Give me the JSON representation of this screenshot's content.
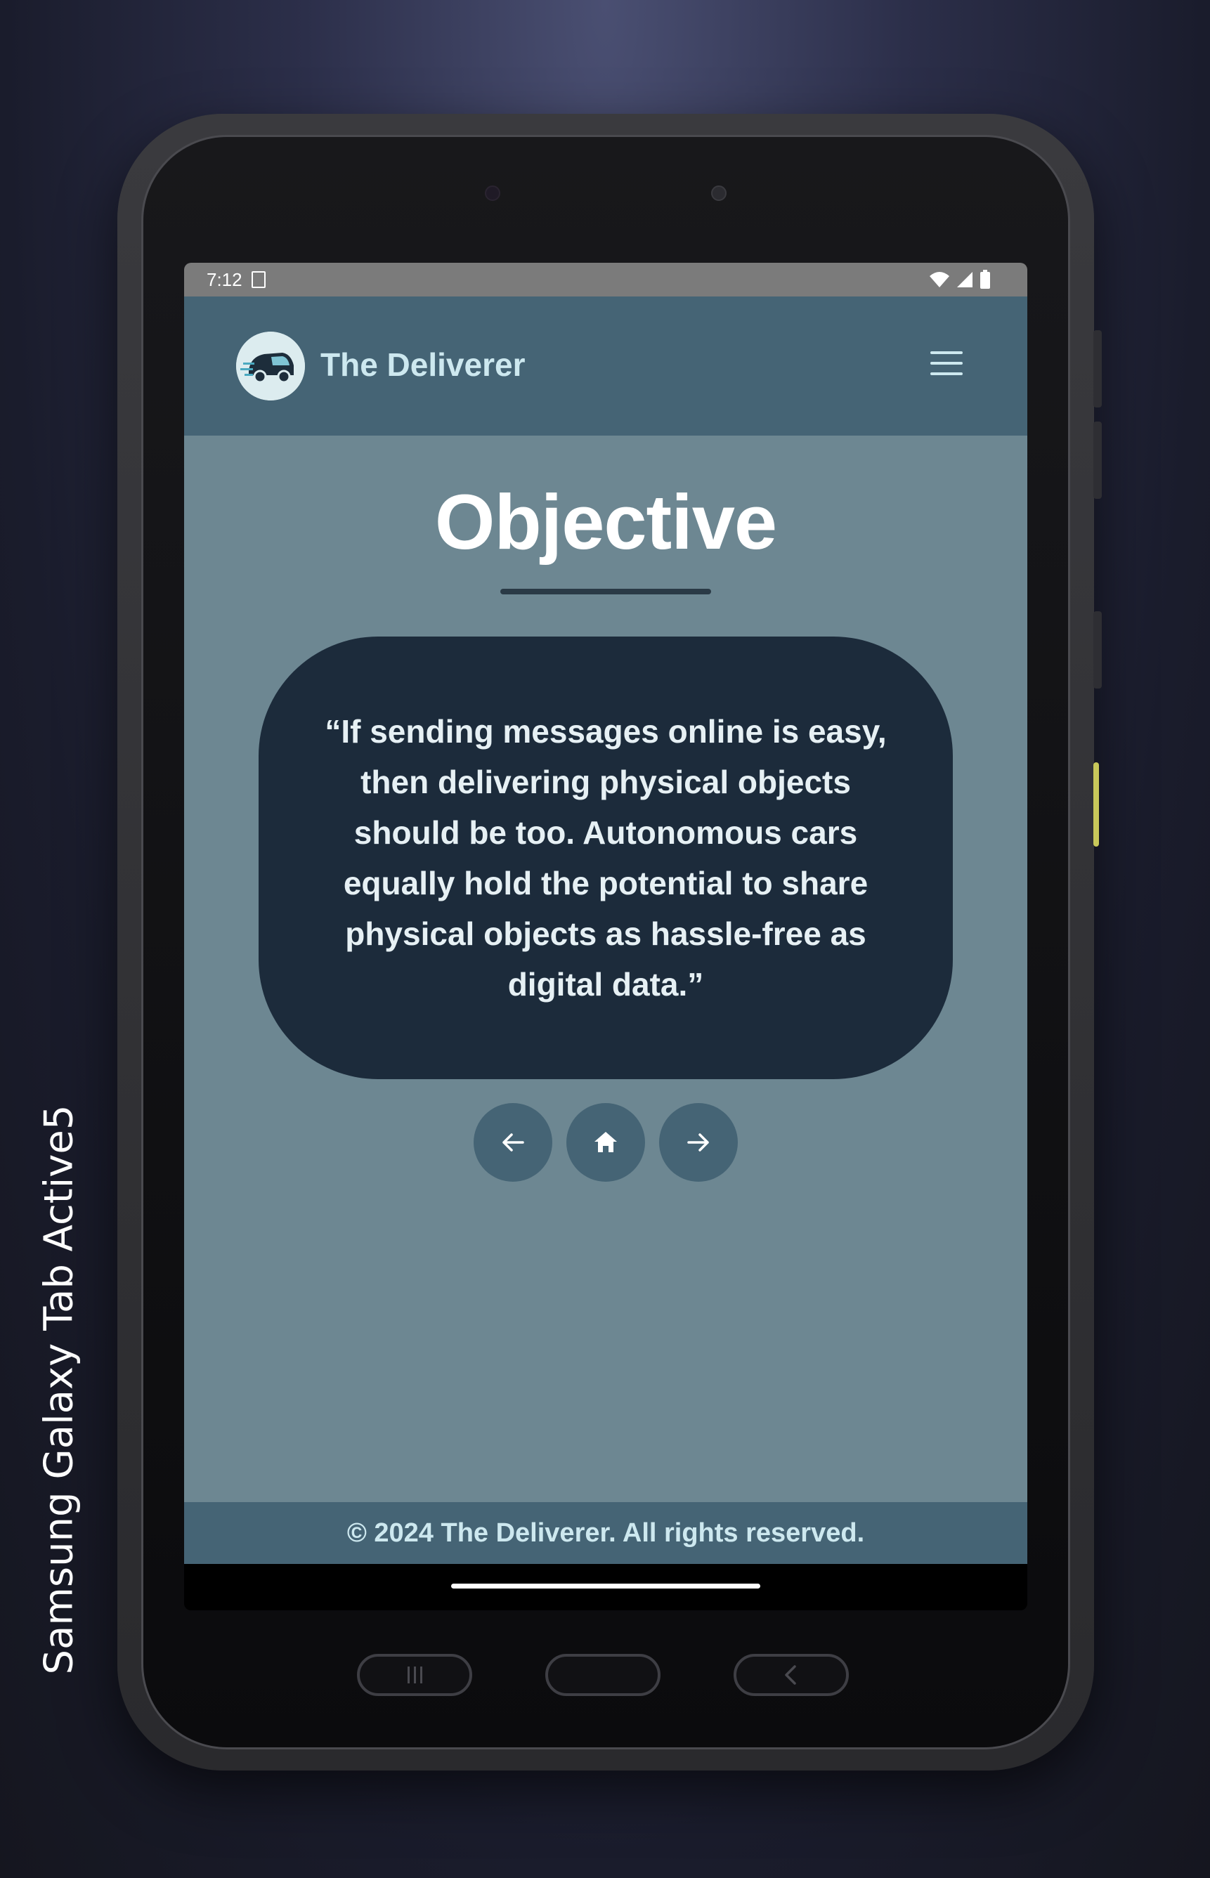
{
  "device": {
    "caption": "Samsung Galaxy  Tab Active5"
  },
  "status_bar": {
    "time": "7:12",
    "icons": [
      "document-icon",
      "wifi-icon",
      "signal-icon",
      "battery-icon"
    ]
  },
  "header": {
    "brand": "The Deliverer",
    "logo_icon": "delivery-van-icon",
    "menu_icon": "hamburger-menu-icon"
  },
  "main": {
    "title": "Objective",
    "quote": "“If sending messages online is easy, then delivering physical objects should be too. Autonomous cars equally hold the potential to share physical objects as hassle-free as digital data.”"
  },
  "nav": {
    "prev_icon": "arrow-left-icon",
    "home_icon": "home-icon",
    "next_icon": "arrow-right-icon"
  },
  "footer": {
    "text": "© 2024 The Deliverer. All rights reserved."
  },
  "system_keys": [
    "recent-apps-icon",
    "home-key",
    "back-icon"
  ],
  "colors": {
    "header_bg": "#456475",
    "main_bg": "#6d8792",
    "card_bg": "#1c2b3b",
    "brand_text": "#cde8ef",
    "status_bar_bg": "#7b7b7b"
  }
}
